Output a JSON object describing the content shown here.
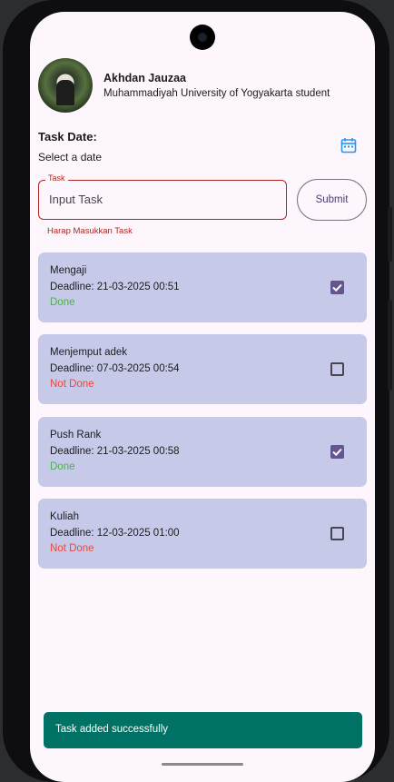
{
  "status_bar": {
    "time": "",
    "icons": ""
  },
  "profile": {
    "name": "Akhdan Jauzaa",
    "subtitle": "Muhammadiyah University of Yogyakarta student"
  },
  "form": {
    "task_date_label": "Task Date:",
    "date_value": "Select a date",
    "task_label": "Task",
    "task_placeholder": "Input Task",
    "error": "Harap Masukkan Task",
    "submit_label": "Submit"
  },
  "tasks": [
    {
      "title": "Mengaji",
      "deadline": "Deadline: 21-03-2025 00:51",
      "status": "Done",
      "checked": true
    },
    {
      "title": "Menjemput adek",
      "deadline": "Deadline: 07-03-2025 00:54",
      "status": "Not Done",
      "checked": false
    },
    {
      "title": "Push Rank",
      "deadline": "Deadline: 21-03-2025 00:58",
      "status": "Done",
      "checked": true
    },
    {
      "title": "Kuliah",
      "deadline": "Deadline: 12-03-2025 01:00",
      "status": "Not Done",
      "checked": false
    }
  ],
  "snackbar": {
    "message": "Task added successfully"
  },
  "colors": {
    "done": "#4caf50",
    "not_done": "#f44336",
    "card": "#c6cae8",
    "accent": "#65558f",
    "error": "#b3261e",
    "snackbar": "#007265",
    "calendar_icon": "#2196f3"
  },
  "icons": {
    "calendar": "calendar-icon",
    "checkbox_checked": "checkbox-checked-icon",
    "checkbox_unchecked": "checkbox-unchecked-icon"
  }
}
